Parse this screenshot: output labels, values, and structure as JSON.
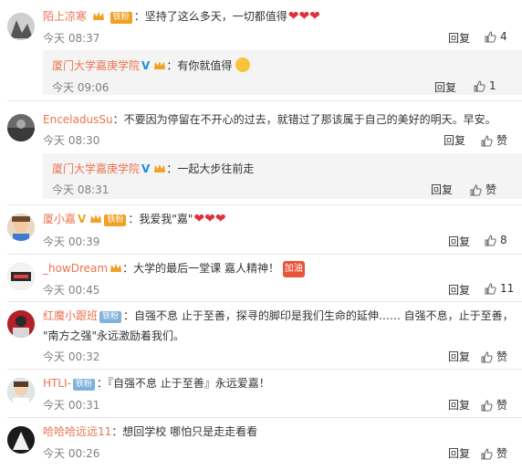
{
  "comments": [
    {
      "user": "陌上凉寒",
      "badge": "铁粉",
      "text": "坚持了这么多天，一切都值得",
      "hearts": "❤❤❤",
      "time": "今天 08:37",
      "reply": "回复",
      "likes": "4",
      "sub": {
        "user": "厦门大学嘉庚学院",
        "text": "有你就值得",
        "time": "今天 09:06",
        "reply": "回复",
        "likes": "1"
      }
    },
    {
      "user": "EnceladusSu",
      "text": "不要因为停留在不开心的过去，就错过了那该属于自己的美好的明天。早安。",
      "time": "今天 08:30",
      "reply": "回复",
      "likes": "赞",
      "sub": {
        "user": "厦门大学嘉庚学院",
        "text": "一起大步往前走",
        "time": "今天 08:31",
        "reply": "回复",
        "likes": "赞"
      }
    },
    {
      "user": "厦小嘉",
      "badge": "铁粉",
      "text": "我爱我\"嘉\"",
      "hearts": "❤❤❤",
      "time": "今天 00:39",
      "reply": "回复",
      "likes": "8"
    },
    {
      "user": "_howDream",
      "text": "大学的最后一堂课 嘉人精神！",
      "sticker": "加油",
      "time": "今天 00:45",
      "reply": "回复",
      "likes": "11"
    },
    {
      "user": "红魔小跟班",
      "badge": "铁粉",
      "text": "自强不息 止于至善，探寻的脚印是我们生命的延伸…… 自强不息，止于至善，",
      "text2": "\"南方之强\"永远激励着我们。",
      "time": "今天 00:32",
      "reply": "回复",
      "likes": "赞"
    },
    {
      "user": "HTLI-",
      "badge": "铁粉",
      "text": "『自强不息 止于至善』永远爱嘉！",
      "time": "今天 00:31",
      "reply": "回复",
      "likes": "赞"
    },
    {
      "user": "哈哈哈远远11",
      "text": "想回学校 哪怕只是走走看看",
      "time": "今天 00:26",
      "reply": "回复",
      "likes": "赞"
    }
  ]
}
